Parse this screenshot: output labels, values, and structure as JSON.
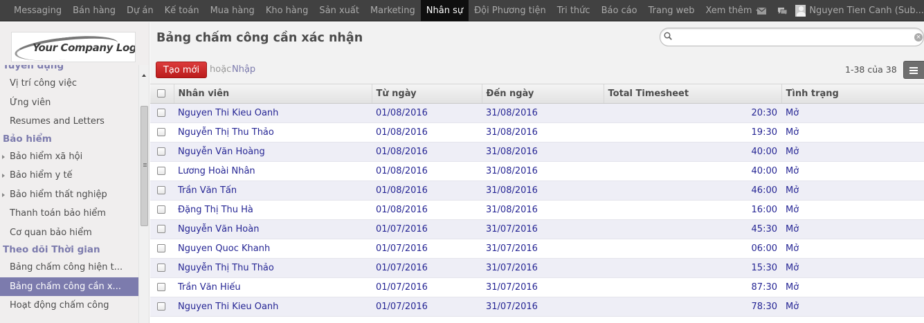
{
  "topbar": {
    "menu": [
      "Messaging",
      "Bán hàng",
      "Dự án",
      "Kế toán",
      "Mua hàng",
      "Kho hàng",
      "Sản xuất",
      "Marketing",
      "Nhân sự",
      "Đội Phương tiện",
      "Tri thức",
      "Báo cáo",
      "Trang web",
      "Xem thêm"
    ],
    "active_index": 8,
    "more_label": "Xem thêm",
    "user_name": "Nguyen Tien Canh (Sub...",
    "mail_icon": "mail-icon",
    "chat_icon": "chat-icon"
  },
  "sidebar": {
    "logo_text": "Your Company Logo",
    "partial_group": "Tuyển dụng",
    "recruit_items": [
      "Vị trí công việc",
      "Ứng viên",
      "Resumes and Letters"
    ],
    "insurance_group": "Bảo hiểm",
    "insurance_items": [
      "Bảo hiểm xã hội",
      "Bảo hiểm y tế",
      "Bảo hiểm thất nghiệp",
      "Thanh toán bảo hiểm",
      "Cơ quan bảo hiểm"
    ],
    "time_group": "Theo dõi Thời gian",
    "time_items": [
      "Bảng chấm công hiện t...",
      "Bảng chấm công cần x...",
      "Hoạt động chấm công"
    ]
  },
  "header": {
    "title": "Bảng chấm công cần xác nhận",
    "search_placeholder": "",
    "create_label": "Tạo mới",
    "or_label": "hoặc",
    "import_label": "Nhập",
    "pager": "1-38 của 38"
  },
  "table": {
    "columns": [
      "Nhân viên",
      "Từ ngày",
      "Đến ngày",
      "Total Timesheet",
      "Tình trạng"
    ],
    "rows": [
      [
        "Nguyen Thi Kieu Oanh",
        "01/08/2016",
        "31/08/2016",
        "20:30",
        "Mở"
      ],
      [
        "Nguyễn Thị Thu Thảo",
        "01/08/2016",
        "31/08/2016",
        "19:30",
        "Mở"
      ],
      [
        "Nguyễn Văn Hoàng",
        "01/08/2016",
        "31/08/2016",
        "40:00",
        "Mở"
      ],
      [
        "Lương Hoài Nhân",
        "01/08/2016",
        "31/08/2016",
        "40:00",
        "Mở"
      ],
      [
        "Trần Văn Tấn",
        "01/08/2016",
        "31/08/2016",
        "46:00",
        "Mở"
      ],
      [
        "Đặng Thị Thu Hà",
        "01/08/2016",
        "31/08/2016",
        "16:00",
        "Mở"
      ],
      [
        "Nguyễn Văn Hoàn",
        "01/07/2016",
        "31/07/2016",
        "45:30",
        "Mở"
      ],
      [
        "Nguyen Quoc Khanh",
        "01/07/2016",
        "31/07/2016",
        "06:00",
        "Mở"
      ],
      [
        "Nguyễn Thị Thu Thảo",
        "01/07/2016",
        "31/07/2016",
        "15:30",
        "Mở"
      ],
      [
        "Trần Văn Hiếu",
        "01/07/2016",
        "31/07/2016",
        "87:30",
        "Mở"
      ],
      [
        "Nguyen Thi Kieu Oanh",
        "01/07/2016",
        "31/07/2016",
        "78:30",
        "Mở"
      ]
    ]
  },
  "colors": {
    "topbar_bg": "#414141",
    "accent": "#7c7bad",
    "link": "#252594",
    "create_button": "#d22b2b"
  }
}
